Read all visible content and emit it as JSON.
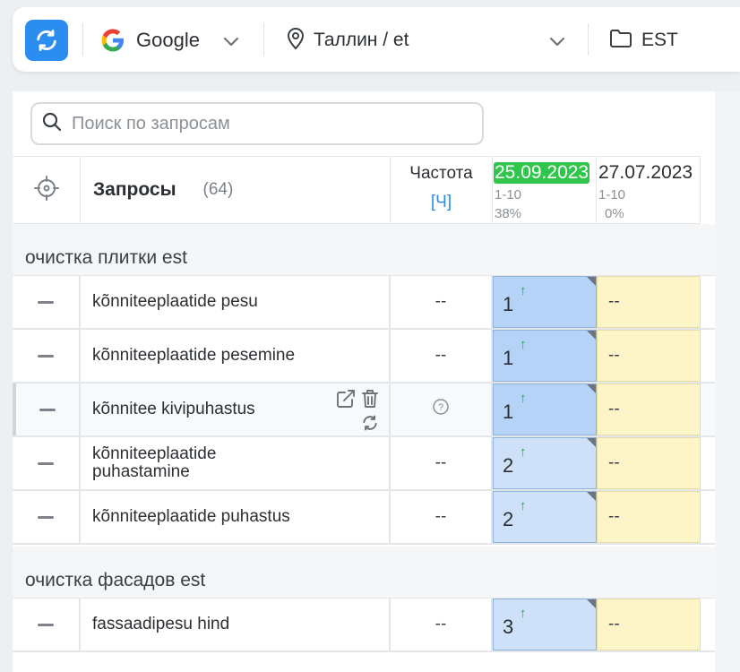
{
  "toolbar": {
    "engine_label": "Google",
    "region_label": "Таллин / et",
    "project_label": "EST"
  },
  "search": {
    "placeholder": "Поиск по запросам"
  },
  "table": {
    "queries_title": "Запросы",
    "queries_count": "(64)",
    "freq_title": "Частота",
    "freq_mode": "[Ч]",
    "dates": [
      {
        "date": "25.09.2023",
        "range": "1-10",
        "pct": "38%",
        "active": true
      },
      {
        "date": "27.07.2023",
        "range": "1-10",
        "pct": "0%",
        "active": false
      }
    ]
  },
  "groups": [
    {
      "label": "очистка плитки est",
      "rows": [
        {
          "query": "kõnniteeplaatide pesu",
          "freq": "--",
          "pos": "1",
          "trend": "↑",
          "prev": "--"
        },
        {
          "query": "kõnniteeplaatide pesemine",
          "freq": "--",
          "pos": "1",
          "trend": "↑",
          "prev": "--"
        },
        {
          "query": "kõnnitee kivipuhastus",
          "freq": "?",
          "pos": "1",
          "trend": "↑",
          "prev": "--"
        },
        {
          "query": "kõnniteeplaatide puhastamine",
          "freq": "--",
          "pos": "2",
          "trend": "↑",
          "prev": "--"
        },
        {
          "query": "kõnniteeplaatide puhastus",
          "freq": "--",
          "pos": "2",
          "trend": "↑",
          "prev": "--"
        }
      ]
    },
    {
      "label": "очистка фасадов est",
      "rows": [
        {
          "query": "fassaadipesu hind",
          "freq": "--",
          "pos": "3",
          "trend": "↑",
          "prev": "--"
        }
      ]
    }
  ],
  "colors": {
    "accent": "#2b8df0",
    "active_date": "#2fc64b",
    "pos_top": "#b5d3f7",
    "pos_mid": "#cfe1f9",
    "prev_cell": "#fdf4c7",
    "trend_up": "#22a94a"
  }
}
